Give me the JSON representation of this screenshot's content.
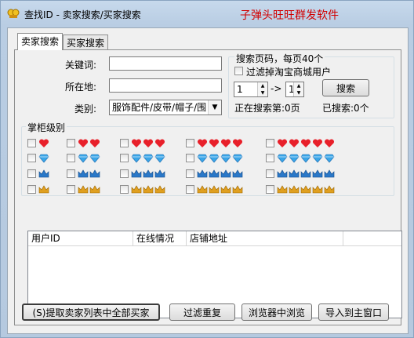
{
  "window": {
    "title": "查找ID - 卖家搜索/买家搜索",
    "brand": "子弹头旺旺群发软件"
  },
  "tabs": [
    {
      "label": "卖家搜索",
      "active": true
    },
    {
      "label": "买家搜索",
      "active": false
    }
  ],
  "form": {
    "keyword_label": "关键词:",
    "keyword_value": "",
    "location_label": "所在地:",
    "location_value": "",
    "category_label": "类别:",
    "category_value": "服饰配件/皮带/帽子/围"
  },
  "search_panel": {
    "title": "搜索页码，每页40个",
    "filter_label": "过滤掉淘宝商城用户",
    "filter_checked": false,
    "page_from": "1",
    "arrow_text": "->",
    "page_to": "1",
    "search_button": "搜索",
    "current_page_text": "正在搜索第:0页",
    "searched_text": "已搜索:0个"
  },
  "level_group": {
    "title": "掌柜级别",
    "icon_colors": {
      "heart": "#e8202a",
      "diamond": "#3aa6e8",
      "crown_blue": "#2a78c8",
      "crown_gold": "#e0a020"
    },
    "rows": [
      {
        "icon": "heart-icon"
      },
      {
        "icon": "diamond-icon"
      },
      {
        "icon": "blue-crown-icon"
      },
      {
        "icon": "gold-crown-icon"
      }
    ]
  },
  "table": {
    "columns": [
      "用户ID",
      "在线情况",
      "店铺地址"
    ],
    "rows": []
  },
  "buttons": {
    "extract": "(S)提取卖家列表中全部买家",
    "filter_dup": "过滤重复",
    "browse": "浏览器中浏览",
    "import": "导入到主窗口"
  }
}
